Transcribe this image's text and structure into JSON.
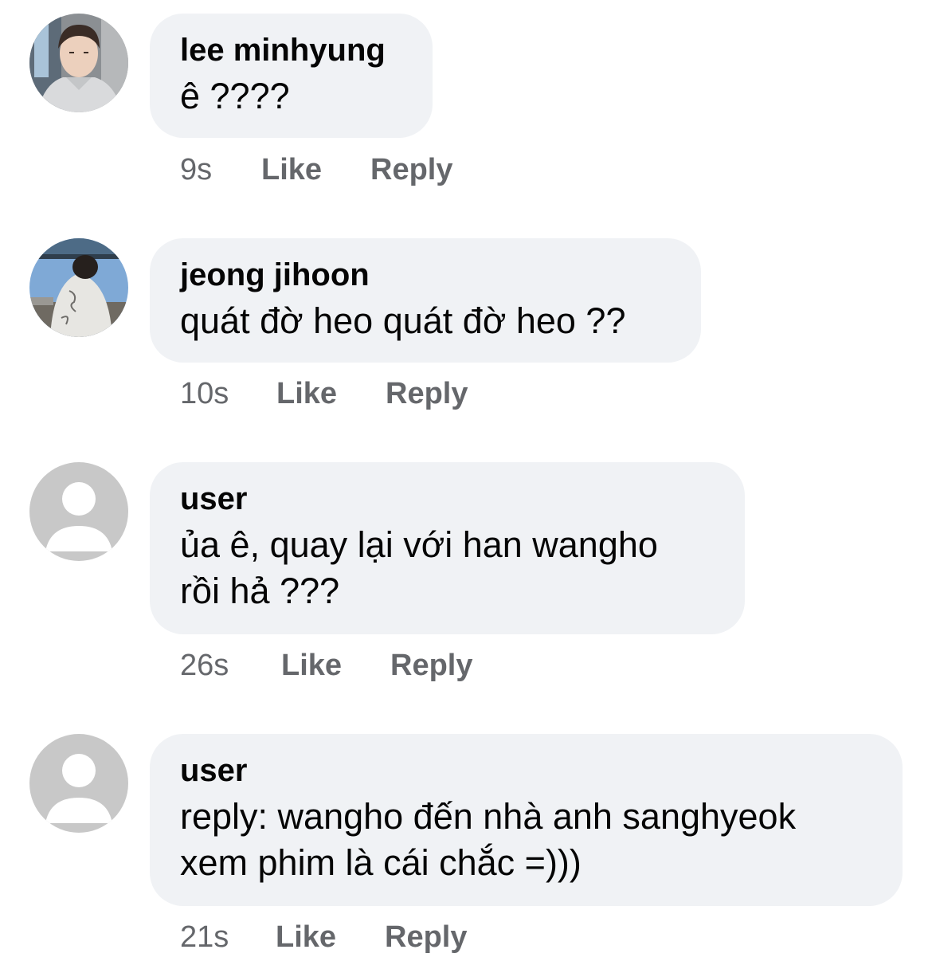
{
  "comments": [
    {
      "author": "lee minhyung",
      "text_lines": [
        "ê ????"
      ],
      "time": "9s",
      "like_label": "Like",
      "reply_label": "Reply",
      "avatar": "profile-photo"
    },
    {
      "author": "jeong jihoon",
      "text_lines": [
        "quát đờ heo quát đờ heo ??"
      ],
      "time": "10s",
      "like_label": "Like",
      "reply_label": "Reply",
      "avatar": "profile-photo"
    },
    {
      "author": "user",
      "text_lines": [
        "ủa ê, quay lại với han wangho",
        "rồi hả ???"
      ],
      "time": "26s",
      "like_label": "Like",
      "reply_label": "Reply",
      "avatar": "default-avatar-icon"
    },
    {
      "author": "user",
      "text_lines": [
        "reply: wangho đến nhà anh sanghyeok",
        "xem phim là cái chắc =)))"
      ],
      "time": "21s",
      "like_label": "Like",
      "reply_label": "Reply",
      "avatar": "default-avatar-icon"
    }
  ],
  "colors": {
    "bubble": "#f0f2f5",
    "meta_text": "#65676b",
    "default_avatar_bg": "#c8c8c8"
  }
}
